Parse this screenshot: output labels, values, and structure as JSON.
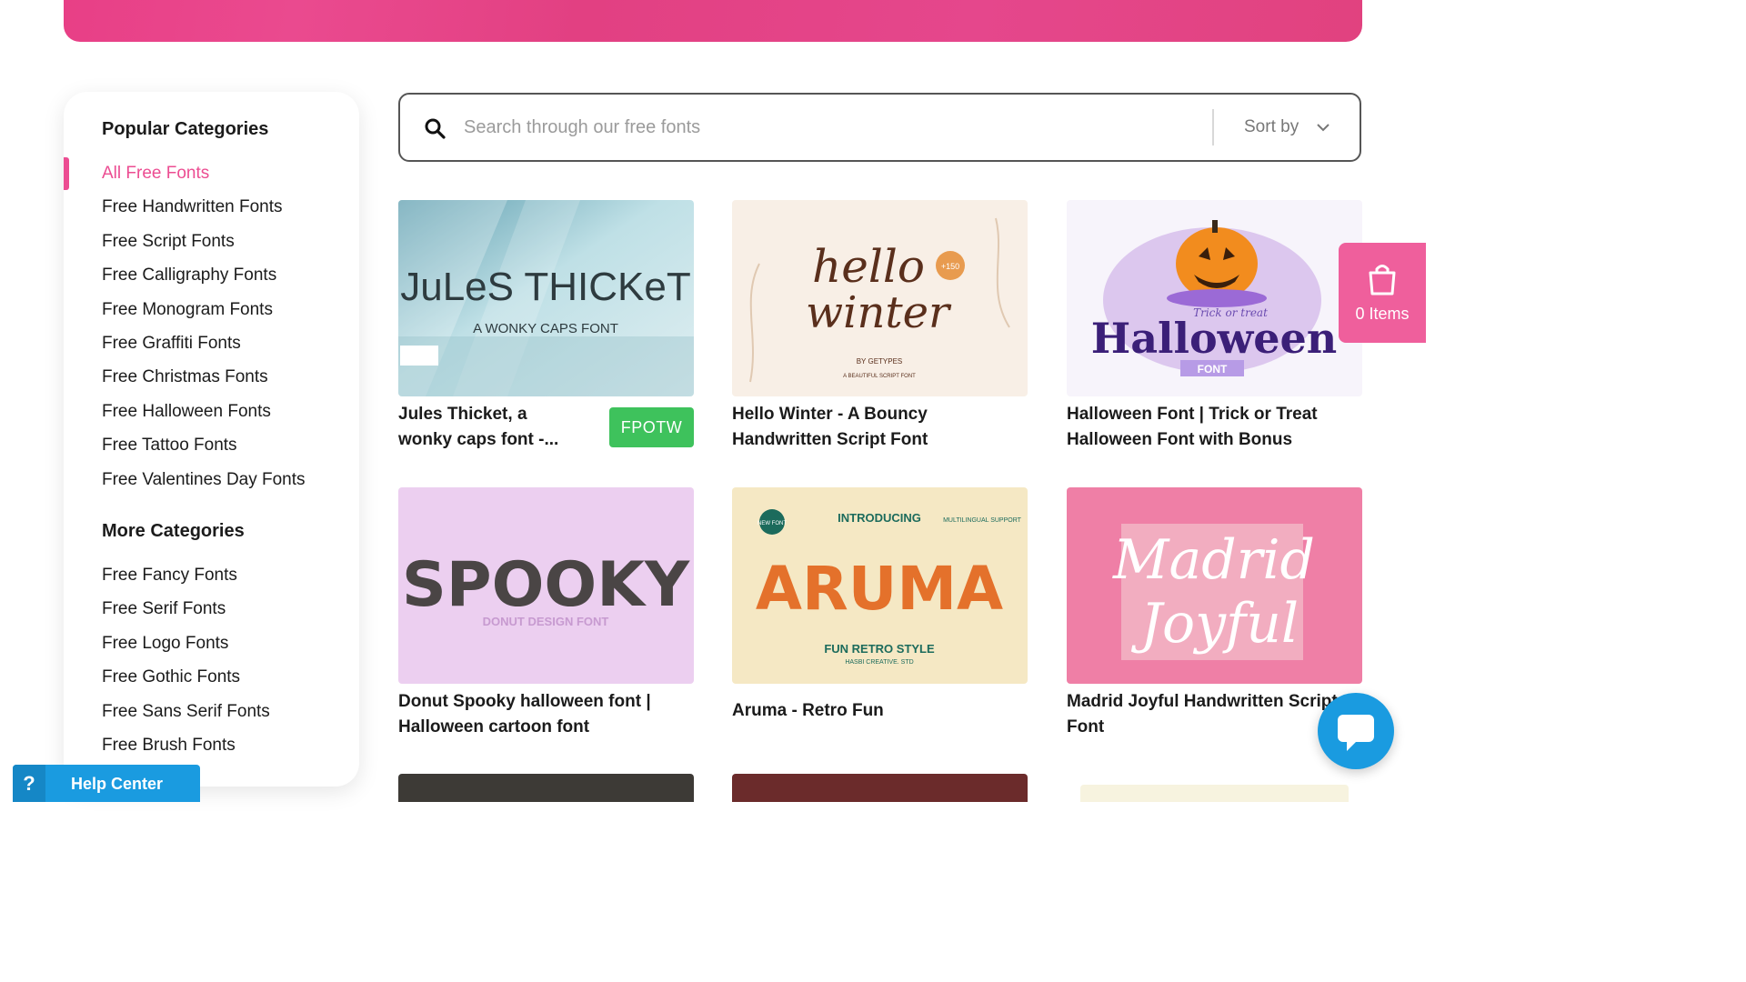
{
  "sidebar": {
    "popular_title": "Popular Categories",
    "popular": [
      "All Free Fonts",
      "Free Handwritten Fonts",
      "Free Script Fonts",
      "Free Calligraphy Fonts",
      "Free Monogram Fonts",
      "Free Graffiti Fonts",
      "Free Christmas Fonts",
      "Free Halloween Fonts",
      "Free Tattoo Fonts",
      "Free Valentines Day Fonts"
    ],
    "more_title": "More Categories",
    "more": [
      "Free Fancy Fonts",
      "Free Serif Fonts",
      "Free Logo Fonts",
      "Free Gothic Fonts",
      "Free Sans Serif Fonts",
      "Free Brush Fonts"
    ]
  },
  "search": {
    "placeholder": "Search through our free fonts",
    "sort_label": "Sort by"
  },
  "cards": [
    {
      "title": "Jules Thicket, a wonky caps font -...",
      "title_line1": "Jules Thicket, a",
      "title_line2": "wonky caps font -...",
      "badge": "FPOTW",
      "art_main": "JuLeS THICKeT",
      "art_sub": "A WONKY CAPS FONT"
    },
    {
      "title_line1": "Hello Winter - A Bouncy",
      "title_line2": "Handwritten Script Font",
      "art_main1": "hello",
      "art_main2": "winter",
      "art_tag": "+150",
      "art_by": "BY GETYPES",
      "art_sub": "A BEAUTIFUL SCRIPT FONT"
    },
    {
      "title_line1": "Halloween Font | Trick or Treat",
      "title_line2": "Halloween Font with Bonus",
      "art_main": "Halloween",
      "art_trick": "Trick or treat",
      "art_font": "FONT"
    },
    {
      "title_line1": "Donut Spooky halloween font |",
      "title_line2": "Halloween cartoon font",
      "art_main": "SPOOKY",
      "art_sub": "DONUT DESIGN FONT"
    },
    {
      "title_line1": "Aruma - Retro Fun",
      "art_intro": "INTRODUCING",
      "art_main": "ARUMA",
      "art_sub1": "FUN RETRO STYLE",
      "art_sub2": "HASBI CREATIVE. STD",
      "art_new": "NEW FONT",
      "art_multi": "MULTILINGUAL SUPPORT"
    },
    {
      "title_line1": "Madrid Joyful Handwritten Script",
      "title_line2": "Font",
      "art_main1": "Madrid",
      "art_main2": "Joyful"
    }
  ],
  "cart": {
    "label": "0 Items"
  },
  "help": {
    "label": "Help Center",
    "q": "?"
  },
  "colors": {
    "accent": "#ec4d92",
    "badge": "#3ec25c",
    "help": "#1a9be0"
  }
}
